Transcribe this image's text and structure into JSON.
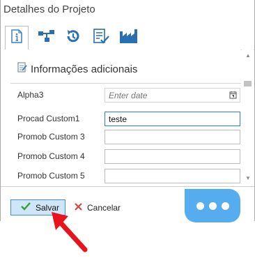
{
  "window": {
    "title": "Detalhes do Projeto"
  },
  "tabs": [
    {
      "name": "info-icon",
      "active": true
    },
    {
      "name": "hierarchy-icon",
      "active": false
    },
    {
      "name": "history-icon",
      "active": false
    },
    {
      "name": "checklist-icon",
      "active": false
    },
    {
      "name": "factory-icon",
      "active": false
    }
  ],
  "section": {
    "title": "Informações adicionais",
    "icon": "edit-document-icon"
  },
  "fields": [
    {
      "label": "Alpha3",
      "placeholder": "Enter date",
      "value": "",
      "type": "date"
    },
    {
      "label": "Procad Custom1",
      "value": "teste",
      "type": "text"
    },
    {
      "label": "Promob Custom 3",
      "value": "",
      "type": "text"
    },
    {
      "label": "Promob Custom 4",
      "value": "",
      "type": "text"
    },
    {
      "label": "Promob Custom 5",
      "value": "",
      "type": "text"
    }
  ],
  "footer": {
    "save_label": "Salvar",
    "cancel_label": "Cancelar"
  },
  "chat": {
    "icon": "chat-bubble-icon"
  },
  "colors": {
    "accent": "#2b7cd3",
    "save_bg": "#cfe6f8",
    "chat_bg": "#55adf0",
    "annotation_arrow": "#e8141d"
  }
}
